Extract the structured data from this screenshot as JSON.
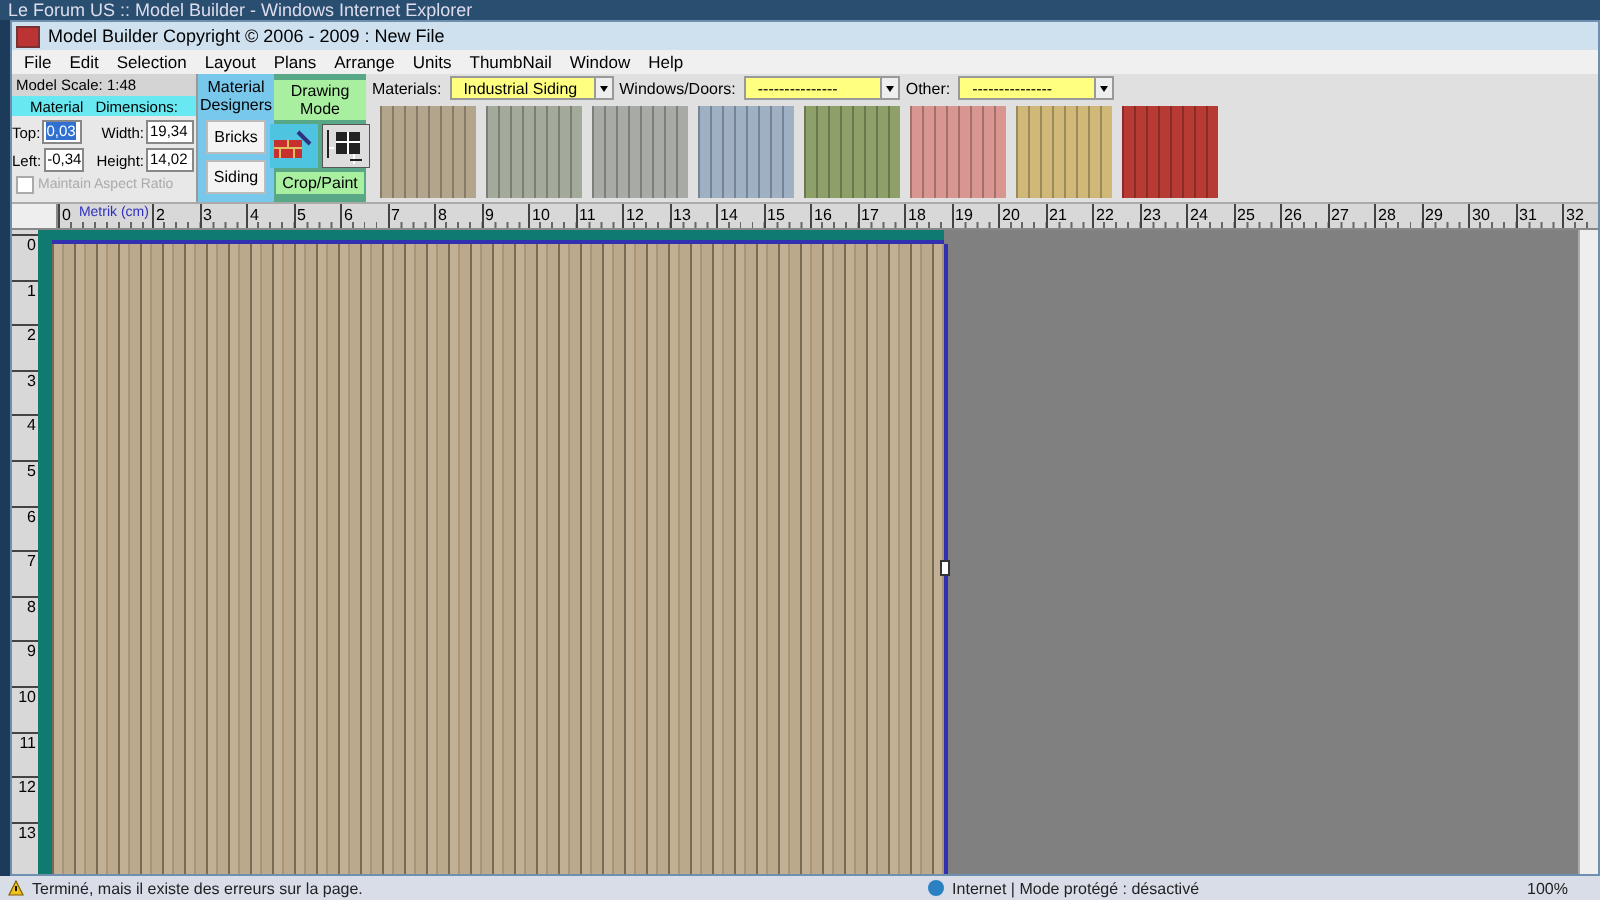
{
  "browser_title": "Le Forum US :: Model Builder - Windows Internet Explorer",
  "window": {
    "title": "Model Builder Copyright © 2006 - 2009 : New File"
  },
  "menu": [
    "File",
    "Edit",
    "Selection",
    "Layout",
    "Plans",
    "Arrange",
    "Units",
    "ThumbNail",
    "Window",
    "Help"
  ],
  "model_scale": "Model Scale: 1:48",
  "dimensions": {
    "title_left": "Material",
    "title_right": "Dimensions:",
    "fields": [
      {
        "label": "Top:",
        "value": "0,03",
        "selected": true
      },
      {
        "label": "Width:",
        "value": "19,34",
        "selected": false
      },
      {
        "label": "Left:",
        "value": "-0,34",
        "selected": false
      },
      {
        "label": "Height:",
        "value": "14,02",
        "selected": false
      }
    ],
    "aspect": {
      "label": "Maintain Aspect Ratio",
      "checked": false,
      "disabled": true
    }
  },
  "designers": {
    "title": "Material Designers",
    "buttons": [
      "Bricks",
      "Siding"
    ]
  },
  "drawing": {
    "title": "Drawing Mode",
    "button": "Crop/Paint"
  },
  "selectors": [
    {
      "label": "Materials:",
      "value": "Industrial Siding"
    },
    {
      "label": "Windows/Doors:",
      "value": "---------------"
    },
    {
      "label": "Other:",
      "value": "---------------"
    }
  ],
  "swatches": [
    {
      "color": "#b3a48c"
    },
    {
      "color": "#a3aa9c"
    },
    {
      "color": "#a8aaa6"
    },
    {
      "color": "#9fb0c4"
    },
    {
      "color": "#8da06a"
    },
    {
      "color": "#d99690"
    },
    {
      "color": "#cfb878"
    },
    {
      "color": "#b83a34"
    }
  ],
  "ruler": {
    "unit": "Metrik (cm)",
    "h_labels": [
      "0",
      "2",
      "3",
      "4",
      "5",
      "6",
      "7",
      "8",
      "9",
      "10",
      "11",
      "12",
      "13",
      "14",
      "15",
      "16",
      "17",
      "18",
      "19",
      "20",
      "21",
      "22",
      "23",
      "24",
      "25",
      "26",
      "27",
      "28",
      "29",
      "30",
      "31",
      "32"
    ],
    "v_labels": [
      "0",
      "1",
      "2",
      "3",
      "4",
      "5",
      "6",
      "7",
      "8",
      "9",
      "10",
      "11",
      "12",
      "13"
    ]
  },
  "status": {
    "message": "Terminé, mais il existe des erreurs sur la page.",
    "zone": "Internet | Mode protégé : désactivé",
    "zoom": "100%"
  }
}
